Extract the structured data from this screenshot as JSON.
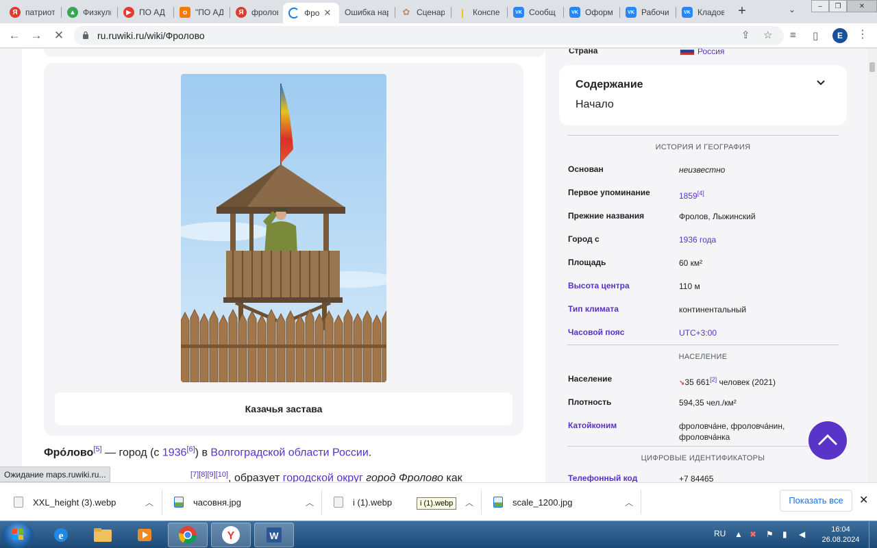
{
  "tabs": [
    {
      "label": "патриот",
      "color": "#e03b2f",
      "letter": "Я"
    },
    {
      "label": "Физкуль",
      "color": "#34a853",
      "letter": "▲"
    },
    {
      "label": "ПО АД",
      "color": "#e53935",
      "letter": "▶"
    },
    {
      "label": "\"ПО АД",
      "color": "#f57c00",
      "letter": "о"
    },
    {
      "label": "фролов",
      "color": "#e03b2f",
      "letter": "Я"
    },
    {
      "label": "Фро",
      "color": "#1a73e8",
      "letter": "",
      "active": true
    },
    {
      "label": "Ошибка нар",
      "color": "",
      "letter": ""
    },
    {
      "label": "Сценар",
      "color": "#9aa0a6",
      "letter": "✿"
    },
    {
      "label": "Конспе",
      "color": "#fbbc04",
      "letter": "|"
    },
    {
      "label": "Сообщ",
      "color": "#2787f5",
      "letter": "VK"
    },
    {
      "label": "Оформ",
      "color": "#2787f5",
      "letter": "VK"
    },
    {
      "label": "Рабочи",
      "color": "#2787f5",
      "letter": "VK"
    },
    {
      "label": "Кладов",
      "color": "#2787f5",
      "letter": "VK"
    }
  ],
  "toolbar": {
    "url": "ru.ruwiki.ru/wiki/Фролово",
    "profile_letter": "E"
  },
  "figure": {
    "caption": "Казачья застава"
  },
  "article": {
    "p1_title": "Фро́лово",
    "p1_ref1": "[5]",
    "p1_t1": " — город (с ",
    "p1_year": "1936",
    "p1_ref2": "[6]",
    "p1_t2": ") в ",
    "p1_link": "Волгоградской области России",
    "p1_end": ".",
    "p2_refs": "[7][8][9][10]",
    "p2_t1": ", образует ",
    "p2_link": "городской округ",
    "p2_italic": " город Фролово",
    "p2_t2": " как"
  },
  "status": "Ожидание maps.ruwiki.ru...",
  "country": {
    "label": "Страна",
    "value": "Россия"
  },
  "toc": {
    "title": "Содержание",
    "item": "Начало"
  },
  "infobox": {
    "section1": "История и география",
    "rows1": [
      {
        "label": "Основан",
        "value": "неизвестно",
        "italic": true
      },
      {
        "label": "Первое упоминание",
        "value": "1859",
        "ref": "[4]",
        "vlink": true
      },
      {
        "label": "Прежние названия",
        "value": "Фролов, Лыжинский"
      },
      {
        "label": "Город с",
        "value": "1936 года",
        "vlink": true
      },
      {
        "label": "Площадь",
        "value": "60 км²"
      },
      {
        "label": "Высота центра",
        "value": "110 м",
        "llink": true
      },
      {
        "label": "Тип климата",
        "value": "континентальный",
        "llink": true
      },
      {
        "label": "Часовой пояс",
        "value": "UTC+3:00",
        "llink": true,
        "vlink": true
      }
    ],
    "section2": "Население",
    "population_label": "Население",
    "population_value": "35 661",
    "population_ref": "[2]",
    "population_unit": " человек (2021)",
    "density_label": "Плотность",
    "density_value": "594,35 чел./км²",
    "katoikonim_label": "Катойконим",
    "katoikonim_value": "фроловча́не, фроловча́нин, фроловча́нка",
    "section3": "Цифровые идентификаторы",
    "phone_label": "Телефонный код",
    "phone_value": "+7 84465"
  },
  "downloads": [
    {
      "name": "XXL_height (3).webp",
      "type": "file"
    },
    {
      "name": "часовня.jpg",
      "type": "img"
    },
    {
      "name": "i (1).webp",
      "type": "file"
    },
    {
      "name": "scale_1200.jpg",
      "type": "img"
    }
  ],
  "download_tooltip": "i (1).webp",
  "show_all": "Показать все",
  "taskbar": {
    "lang": "RU",
    "time": "16:04",
    "date": "26.08.2024"
  },
  "colors": {
    "link": "#5631c8",
    "accent": "#5a33c9"
  }
}
